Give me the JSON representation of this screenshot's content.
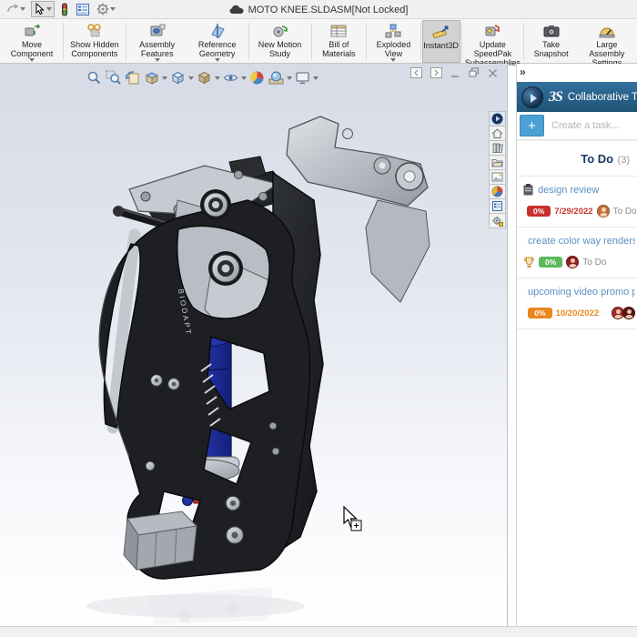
{
  "titlebar": {
    "title": "MOTO KNEE.SLDASM[Not Locked]"
  },
  "ribbon": {
    "buttons": [
      {
        "label": "Move Component",
        "dropdown": true
      },
      {
        "label": "Show Hidden Components",
        "dropdown": false
      },
      {
        "label": "Assembly Features",
        "dropdown": true
      },
      {
        "label": "Reference Geometry",
        "dropdown": true
      },
      {
        "label": "New Motion Study",
        "dropdown": false
      },
      {
        "label": "Bill of Materials",
        "dropdown": false
      },
      {
        "label": "Exploded View",
        "dropdown": true
      },
      {
        "label": "Instant3D",
        "dropdown": false
      },
      {
        "label": "Update SpeedPak Subassemblies",
        "dropdown": false
      },
      {
        "label": "Take Snapshot",
        "dropdown": false
      },
      {
        "label": "Large Assembly Settings",
        "dropdown": false
      }
    ]
  },
  "viewport": {
    "model_label": "BIODAPT"
  },
  "task_pane": {
    "collapse_chevron": "»",
    "logo_text": "3S",
    "header_title": "Collaborative Ta",
    "create_task": {
      "button_label": "+",
      "placeholder": "Create a task..."
    },
    "section": {
      "title": "To Do",
      "count": "(3)"
    },
    "tasks": [
      {
        "title": "design review",
        "progress": "0%",
        "progress_color": "#c9302c",
        "date": "7/29/2022",
        "date_color": "#c9302c",
        "status": "To Do",
        "avatar_color": "#c2703a"
      },
      {
        "title": "create color way renders",
        "progress": "0%",
        "progress_color": "#5cb85c",
        "date": "",
        "date_color": "#5cb85c",
        "status": "To Do",
        "avatar_color": "#8e2020"
      },
      {
        "title": "upcoming video promo pro",
        "progress": "0%",
        "progress_color": "#e8871e",
        "date": "10/20/2022",
        "date_color": "#e8871e",
        "status": "",
        "avatar_color": "#9e2a2a",
        "avatar2_color": "#5a1414"
      }
    ]
  }
}
